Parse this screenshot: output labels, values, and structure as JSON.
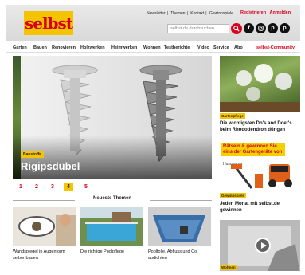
{
  "header": {
    "logo_text": "selbst",
    "top_links": [
      "Newsletter",
      "|",
      "Themen",
      "|",
      "Kontakt",
      "|",
      "Gewinnspiele"
    ],
    "register": "Registrieren",
    "login": "Anmelden",
    "search_placeholder": "selbst.de durchsuchen...",
    "social": [
      "f",
      "t",
      "p",
      "p"
    ]
  },
  "nav": {
    "items": [
      "Garten",
      "Bauen",
      "Renovieren",
      "Holzwerken",
      "Heimwerken",
      "Wohnen",
      "Testberichte",
      "Video",
      "Service",
      "Abo"
    ],
    "community": "selbst-Community"
  },
  "hero": {
    "badge": "Baustoffe",
    "title": "Rigipsdübel"
  },
  "pager": [
    "1",
    "2",
    "3",
    "4",
    "5"
  ],
  "pager_active": "4",
  "right": {
    "teaser1": {
      "badge": "Gartenpflege",
      "title": "Die wichtigsten Do's and Doet's beim Rhododendron düngen"
    },
    "ad": {
      "headline": "Rätseln & gewinnen Sie eins der Gartengeräte von",
      "brand": "Husqvarna"
    },
    "teaser2": {
      "badge": "Gewinnspiele",
      "title": "Jeden Monat mit selbst.de gewinnen"
    },
    "teaser3": {
      "badge": "Wohnen"
    }
  },
  "neueste": {
    "title": "Neueste Themen",
    "cards": [
      {
        "title": "Wandspiegel in Augenform selber bauen"
      },
      {
        "title": "Die richtige Poolpflege"
      },
      {
        "title": "Poolfolie, Abfluss und Co. abdichten"
      }
    ]
  },
  "colors": {
    "brand_red": "#d8001c",
    "brand_yellow": "#f4c400"
  },
  "icons": [
    "search-icon",
    "facebook-icon",
    "instagram-icon",
    "pinterest-icon",
    "play-icon"
  ]
}
